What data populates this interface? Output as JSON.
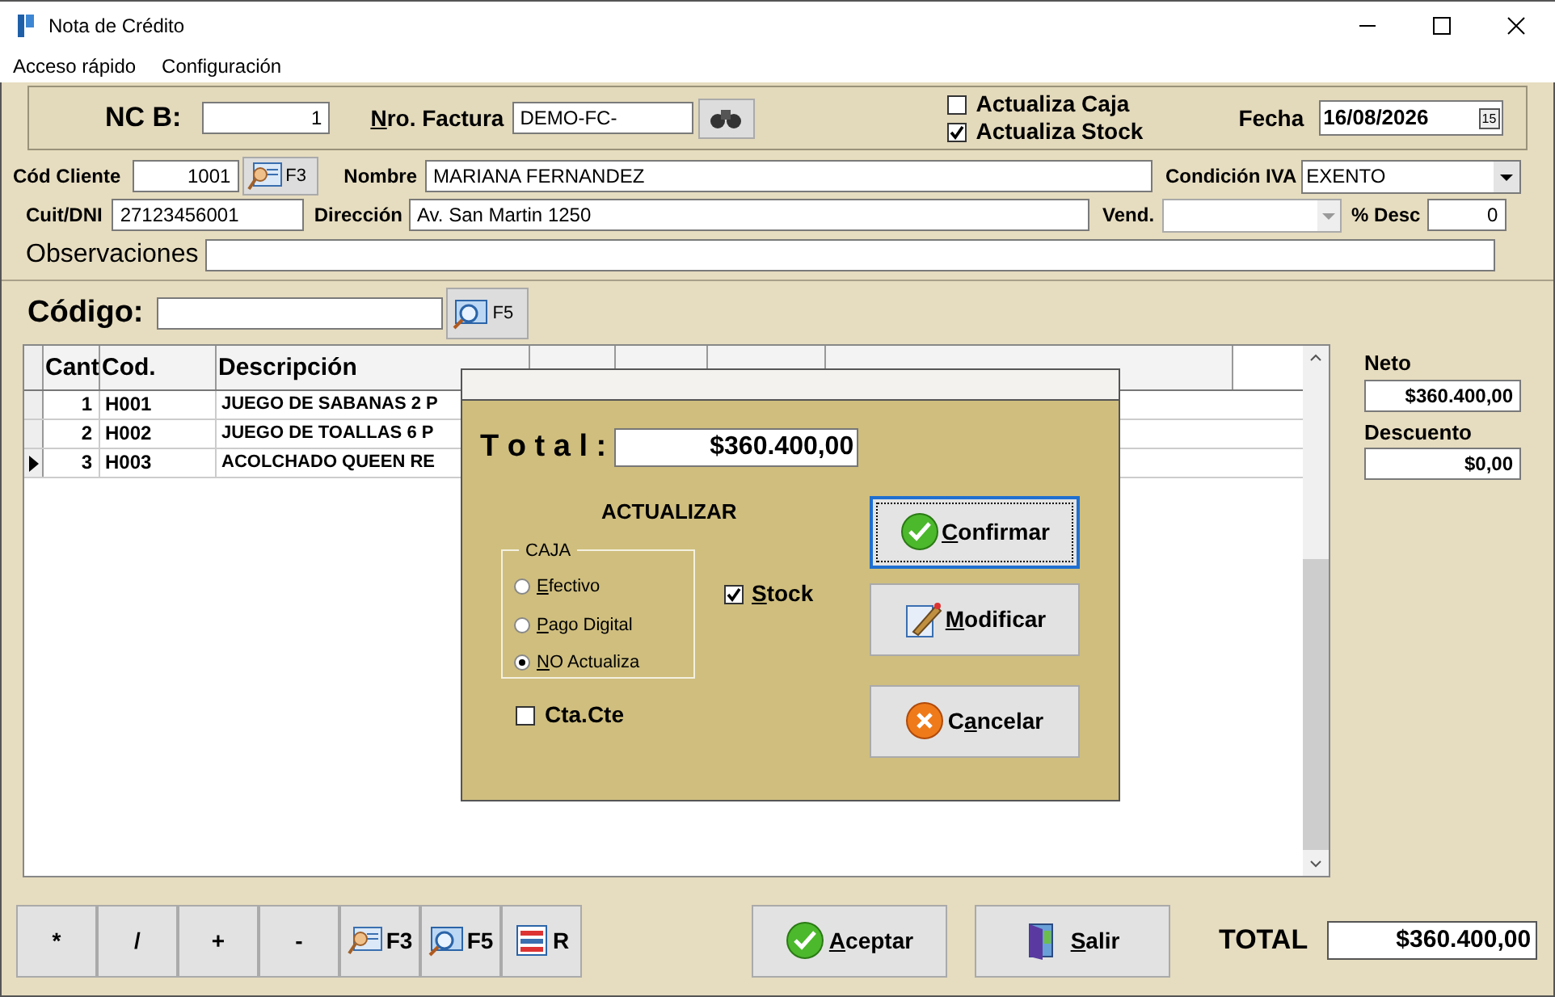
{
  "window": {
    "title": "Nota de Crédito"
  },
  "menu": [
    "Acceso rápido",
    "Configuración"
  ],
  "header": {
    "nc_label": "NC B:",
    "nc_value": "1",
    "factura_label": {
      "key": "N",
      "rest": "ro. Factura"
    },
    "factura_value": "DEMO-FC-",
    "checks": [
      {
        "label": "Actualiza Caja",
        "checked": false
      },
      {
        "label": "Actualiza Stock",
        "checked": true
      }
    ],
    "fecha_label": "Fecha",
    "fecha_value": "16/08/2026",
    "calendar_glyph": "15"
  },
  "client": {
    "cod_label": "Cód Cliente",
    "cod_value": "1001",
    "cod_key": "F3",
    "nombre_label": "Nombre",
    "nombre_value": "MARIANA FERNANDEZ",
    "iva_label": "Condición IVA",
    "iva_value": "EXENTO",
    "cuit_label": "Cuit/DNI",
    "cuit_value": "27123456001",
    "dir_label": "Dirección",
    "dir_value": "Av. San Martin 1250",
    "vend_label": "Vend.",
    "desc_label": "% Desc",
    "desc_value": "0",
    "obs_label": "Observaciones"
  },
  "codigo": {
    "label": "Código:",
    "key": "F5"
  },
  "table": {
    "columns": [
      "Cant",
      "Cod.",
      "Descripción"
    ],
    "rows": [
      {
        "cant": "1",
        "cod": "H001",
        "desc": "JUEGO DE SABANAS 2 P",
        "selected": false
      },
      {
        "cant": "2",
        "cod": "H002",
        "desc": "JUEGO DE TOALLAS 6 P",
        "selected": false
      },
      {
        "cant": "3",
        "cod": "H003",
        "desc": "ACOLCHADO QUEEN RE",
        "selected": true
      }
    ]
  },
  "side": {
    "neto_label": "Neto",
    "neto_value": "$360.400,00",
    "descuento_label": "Descuento",
    "descuento_value": "$0,00"
  },
  "dialog": {
    "total_label": "T o t a l :",
    "total_value": "$360.400,00",
    "heading": "ACTUALIZAR",
    "caja_label": "CAJA",
    "radios": [
      {
        "label": {
          "key": "E",
          "rest": "fectivo"
        },
        "selected": false
      },
      {
        "label": {
          "key": "P",
          "rest": "ago Digital"
        },
        "selected": false
      },
      {
        "label": {
          "key": "N",
          "rest": "O Actualiza"
        },
        "selected": true
      }
    ],
    "stock": {
      "label": {
        "key": "S",
        "rest": "tock"
      },
      "checked": true
    },
    "ctacte": {
      "label": "Cta.Cte",
      "checked": false
    },
    "buttons": [
      {
        "kind": "confirm",
        "label": {
          "key": "C",
          "rest": "onfirmar"
        },
        "focused": true
      },
      {
        "kind": "edit",
        "label": {
          "key": "M",
          "rest": "odificar"
        },
        "focused": false
      },
      {
        "kind": "cancel",
        "label": {
          "lead": "C",
          "key": "a",
          "rest": "ncelar"
        },
        "focused": false
      }
    ]
  },
  "keypad": [
    {
      "kind": "text",
      "label": "*"
    },
    {
      "kind": "text",
      "label": "/"
    },
    {
      "kind": "text",
      "label": "+"
    },
    {
      "kind": "text",
      "label": "-"
    },
    {
      "kind": "client",
      "label": "F3"
    },
    {
      "kind": "search",
      "label": "F5"
    },
    {
      "kind": "list",
      "label": "R"
    }
  ],
  "footer": {
    "aceptar": {
      "key": "A",
      "rest": "ceptar"
    },
    "salir": {
      "key": "S",
      "rest": "alir"
    },
    "total_label": "TOTAL",
    "total_value": "$360.400,00"
  }
}
